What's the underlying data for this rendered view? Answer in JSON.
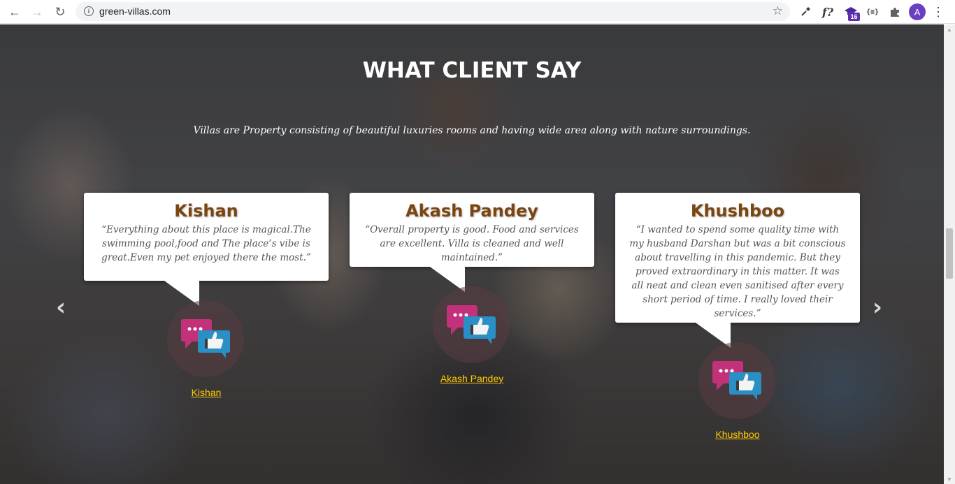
{
  "browser": {
    "url": "green-villas.com",
    "back_icon": "←",
    "forward_icon": "→",
    "reload_icon": "↻",
    "info_icon": "i",
    "star_icon": "☆",
    "extensions": {
      "eyedropper_icon": "eyedropper-icon",
      "formula_label": "f?",
      "graduation_badge": "16",
      "braces_label": "{≡}",
      "puzzle_icon": "puzzle-icon"
    },
    "avatar_letter": "A",
    "menu_icon": "⋮"
  },
  "testimonials": {
    "title": "WHAT CLIENT SAY",
    "subtitle": "Villas are Property consisting of beautiful luxuries rooms and having wide area along with nature surroundings.",
    "items": [
      {
        "name": "Kishan",
        "quote": "“Everything about this place is magical.The swimming pool,food and The place’s vibe is great.Even my pet enjoyed there the most.”",
        "link": "Kishan"
      },
      {
        "name": "Akash Pandey",
        "quote": "“Overall property is good. Food and services are excellent. Villa is cleaned and well maintained.”",
        "link": "Akash Pandey"
      },
      {
        "name": "Khushboo",
        "quote": "“I wanted to spend some quality time with my husband Darshan but was a bit conscious about travelling in this pandemic. But they proved extraordinary in this matter. It was all neat and clean even sanitised after every short period of time. I really loved their services.”",
        "link": "Khushboo"
      }
    ],
    "prev_arrow": "‹",
    "next_arrow": "›"
  },
  "colors": {
    "name": "#7a4511",
    "link": "#ffcc00",
    "avatar": "#6a3fc1"
  }
}
